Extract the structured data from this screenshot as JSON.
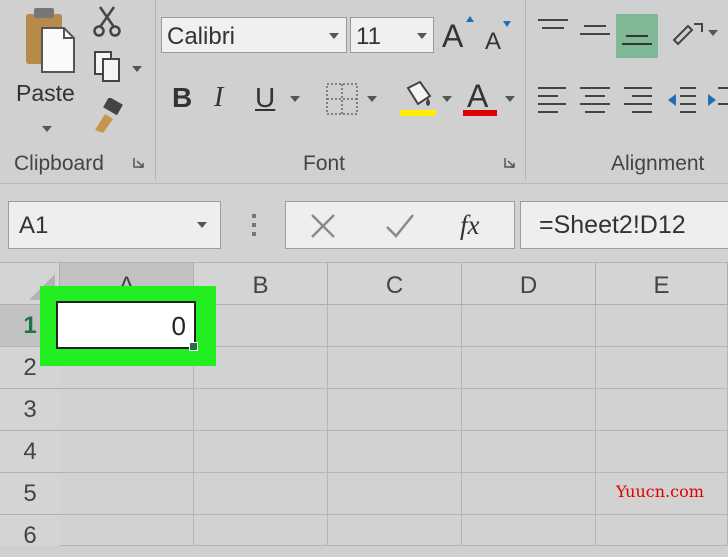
{
  "ribbon": {
    "clipboard": {
      "paste_label": "Paste",
      "group_label": "Clipboard"
    },
    "font": {
      "font_name": "Calibri",
      "font_size": "11",
      "grow_label": "A",
      "shrink_label": "A",
      "bold_label": "B",
      "italic_label": "I",
      "underline_label": "U",
      "fill_color": "#ffee00",
      "font_color": "#dd0000",
      "font_color_label": "A",
      "group_label": "Font"
    },
    "alignment": {
      "group_label": "Alignment"
    }
  },
  "formula_bar": {
    "name_box": "A1",
    "fx_label": "fx",
    "formula": "=Sheet2!D12"
  },
  "sheet": {
    "columns": [
      "A",
      "B",
      "C",
      "D",
      "E"
    ],
    "rows": [
      "1",
      "2",
      "3",
      "4",
      "5",
      "6"
    ],
    "active_cell_value": "0",
    "highlight_color": "#22ee22"
  },
  "watermark": "Yuucn.com"
}
